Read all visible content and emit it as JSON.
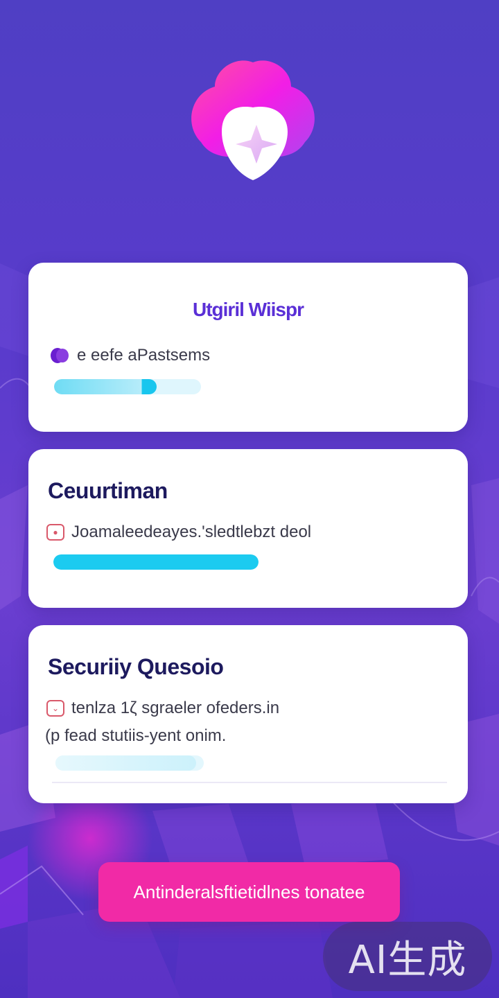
{
  "colors": {
    "background_top": "#4f3fc4",
    "background_bottom": "#4e2fc0",
    "accent_purple": "#5a2fd6",
    "progress_cyan": "#1ccbf0",
    "cta_pink": "#f12aa6",
    "heading_navy": "#1d1a5e"
  },
  "logo": {
    "icon": "shield-heart-logo-icon"
  },
  "card1": {
    "title": "Utgiril Wiispr",
    "row_icon": "purple-blob-icon",
    "row_text": "e eefe aPastsems",
    "progress": 0.7
  },
  "card2": {
    "title": "Ceuurtiman",
    "row_icon": "alert-box-icon",
    "row_text": "Joamaleedeayes.'sledtlebzt deol",
    "progress": 1.0
  },
  "card3": {
    "title": "Securiiy Quesoio",
    "row_icon": "chevron-down-box-icon",
    "row_text": "tenlza 1ζ sgraeler ofeders.in",
    "row_text_2": "(p fead stutiis-yent onim.",
    "progress": 0.95
  },
  "cta": {
    "label": "Antinderalsftietidlnes tonatee"
  },
  "watermark": {
    "text": "AI生成"
  }
}
